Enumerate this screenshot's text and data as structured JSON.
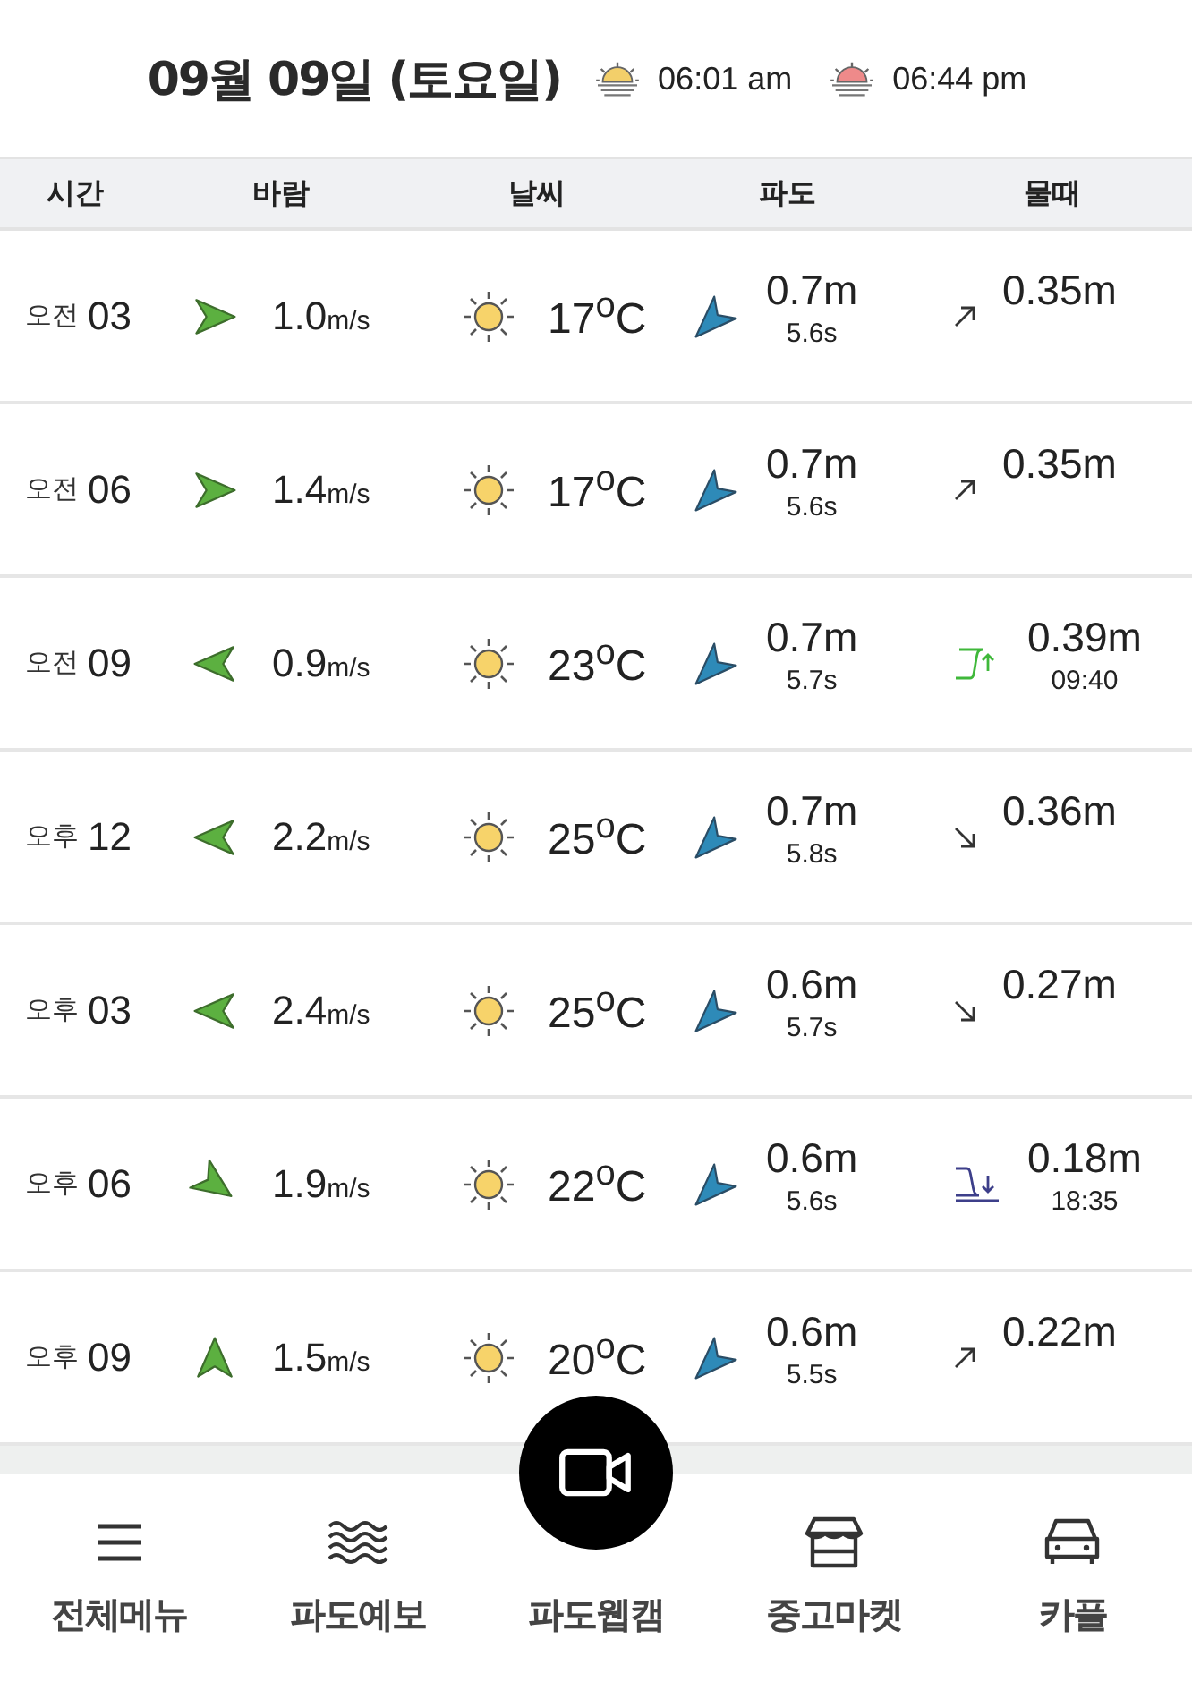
{
  "header": {
    "date": "09월 09일 (토요일)",
    "sunrise": "06:01 am",
    "sunset": "06:44 pm"
  },
  "columns": [
    "시간",
    "바람",
    "날씨",
    "파도",
    "물때"
  ],
  "rows": [
    {
      "ampm": "오전",
      "hour": "03",
      "wind": {
        "kind": "east",
        "speed": "1.0",
        "unit": "m/s"
      },
      "temp": "17$^{o}$C",
      "wave": "0.7m",
      "period": "5.6s",
      "tide": {
        "kind": "rising",
        "height": "0.35m"
      }
    },
    {
      "ampm": "오전",
      "hour": "06",
      "wind": {
        "kind": "east",
        "speed": "1.4",
        "unit": "m/s"
      },
      "temp": "17$^{o}$C",
      "wave": "0.7m",
      "period": "5.6s",
      "tide": {
        "kind": "rising",
        "height": "0.35m"
      }
    },
    {
      "ampm": "오전",
      "hour": "09",
      "wind": {
        "kind": "west",
        "speed": "0.9",
        "unit": "m/s"
      },
      "temp": "23$^{o}$C",
      "wave": "0.7m",
      "period": "5.7s",
      "tide": {
        "kind": "high",
        "height": "0.39m",
        "time": "09:40"
      }
    },
    {
      "ampm": "오후",
      "hour": "12",
      "wind": {
        "kind": "west",
        "speed": "2.2",
        "unit": "m/s"
      },
      "temp": "25$^{o}$C",
      "wave": "0.7m",
      "period": "5.8s",
      "tide": {
        "kind": "falling",
        "height": "0.36m"
      }
    },
    {
      "ampm": "오후",
      "hour": "03",
      "wind": {
        "kind": "west",
        "speed": "2.4",
        "unit": "m/s"
      },
      "temp": "25$^{o}$C",
      "wave": "0.6m",
      "period": "5.7s",
      "tide": {
        "kind": "falling",
        "height": "0.27m"
      }
    },
    {
      "ampm": "오후",
      "hour": "06",
      "wind": {
        "kind": "southeast",
        "speed": "1.9",
        "unit": "m/s"
      },
      "temp": "22$^{o}$C",
      "wave": "0.6m",
      "period": "5.6s",
      "tide": {
        "kind": "low",
        "height": "0.18m",
        "time": "18:35"
      }
    },
    {
      "ampm": "오후",
      "hour": "09",
      "wind": {
        "kind": "north",
        "speed": "1.5",
        "unit": "m/s"
      },
      "temp": "20$^{o}$C",
      "wave": "0.6m",
      "period": "5.5s",
      "tide": {
        "kind": "rising",
        "height": "0.22m"
      }
    }
  ],
  "nav": [
    {
      "kind": "menu",
      "label": "전체메뉴"
    },
    {
      "kind": "waves",
      "label": "파도예보"
    },
    {
      "kind": "webcam",
      "label": "파도웹캠"
    },
    {
      "kind": "market",
      "label": "중고마켓"
    },
    {
      "kind": "car",
      "label": "카풀"
    }
  ]
}
